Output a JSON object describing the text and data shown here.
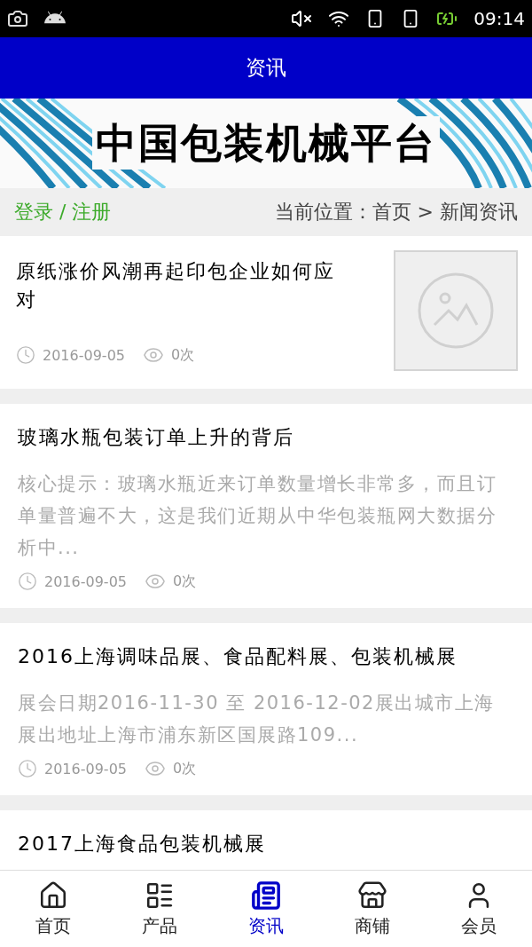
{
  "status_bar": {
    "time": "09:14"
  },
  "header": {
    "title": "资讯"
  },
  "banner": {
    "title": "中国包装机械平台"
  },
  "breadcrumb": {
    "login": "登录 / 注册",
    "location": "当前位置：首页 > 新闻资讯"
  },
  "articles": [
    {
      "kind": "thumb",
      "title": "原纸涨价风潮再起印包企业如何应对",
      "date": "2016-09-05",
      "views": "0次"
    },
    {
      "kind": "text",
      "title": "玻璃水瓶包装订单上升的背后",
      "summary": "核心提示：玻璃水瓶近来订单数量增长非常多，而且订单量普遍不大，这是我们近期从中华包装瓶网大数据分析中...",
      "date": "2016-09-05",
      "views": "0次"
    },
    {
      "kind": "text",
      "title": "2016上海调味品展、食品配料展、包装机械展",
      "summary": "展会日期2016-11-30 至 2016-12-02展出城市上海展出地址上海市浦东新区国展路109...",
      "date": "2016-09-05",
      "views": "0次"
    },
    {
      "kind": "text",
      "title": "2017上海食品包装机械展"
    }
  ],
  "tab_bar": [
    {
      "label": "首页",
      "selected": false
    },
    {
      "label": "产品",
      "selected": false
    },
    {
      "label": "资讯",
      "selected": true
    },
    {
      "label": "商铺",
      "selected": false
    },
    {
      "label": "会员",
      "selected": false
    }
  ]
}
